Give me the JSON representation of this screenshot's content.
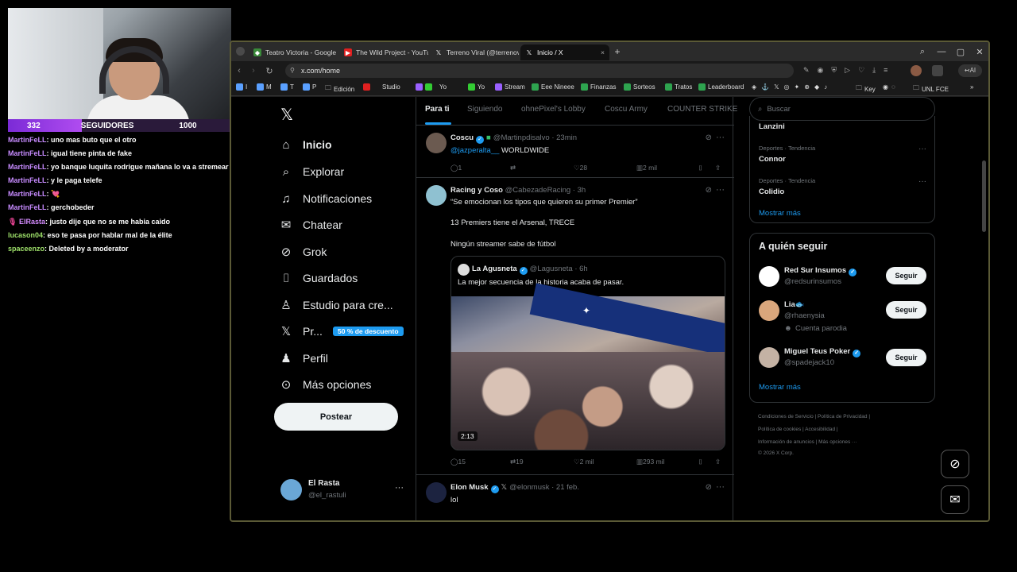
{
  "stream": {
    "followers_current": "332",
    "followers_label": "SEGUIDORES",
    "followers_goal": "1000",
    "followers_progress": 0.332
  },
  "chat": [
    {
      "user": "MartinFeLL",
      "msg": ": uno mas buto que el otro"
    },
    {
      "user": "MartinFeLL",
      "msg": ": igual tiene pinta de fake"
    },
    {
      "user": "MartinFeLL",
      "msg": ": yo banque luquita rodrigue mañana lo va a stremear"
    },
    {
      "user": "MartinFeLL",
      "msg": ": y le paga telefe"
    },
    {
      "user": "MartinFeLL",
      "msg": ": 💘"
    },
    {
      "user": "MartinFeLL",
      "msg": ": gerchobeder"
    },
    {
      "user": "ElRasta",
      "msg": ": justo dije que no se me habia caido"
    },
    {
      "user": "lucason04",
      "msg": ": eso te pasa por hablar mal de la élite"
    },
    {
      "user": "spaceenzo",
      "msg": ": Deleted by a moderator"
    }
  ],
  "browser": {
    "tabs": [
      "Teatro Victoria - Google",
      "The Wild Project - YouTu",
      "Terreno Viral (@terrenov",
      "Inicio / X"
    ],
    "new_tab": "+",
    "url": "x.com/home",
    "bookmarks": [
      "I",
      "M",
      "T",
      "P",
      "Edición",
      "Studio",
      "Yo",
      "Yo",
      "Stream",
      "Eee Nineee",
      "Finanzas",
      "Sorteos",
      "Tratos",
      "Leaderboard",
      "Key",
      "UNL FCE"
    ]
  },
  "nav": {
    "items": [
      "Inicio",
      "Explorar",
      "Notificaciones",
      "Chatear",
      "Grok",
      "Guardados",
      "Estudio para cre...",
      "Pr...",
      "Perfil",
      "Más opciones"
    ],
    "promo": "50 % de descuento",
    "post": "Postear",
    "account_name": "El Rasta",
    "account_handle": "@el_rastuli"
  },
  "feed": {
    "tabs": [
      "Para ti",
      "Siguiendo",
      "ohnePixel's Lobby",
      "Coscu Army",
      "COUNTER STRIKE"
    ],
    "tweets": [
      {
        "name": "Coscu",
        "handle": "@Martinpdisalvo · 23min",
        "text_link": "@jazperalta__",
        "text": " WORLDWIDE",
        "replies": "1",
        "retweets": "",
        "likes": "28",
        "views": "2 mil"
      },
      {
        "name": "Racing y Coso",
        "handle": "@CabezadeRacing · 3h",
        "lines": [
          "“Se emocionan los tipos que quieren su primer Premier”",
          "13 Premiers tiene el Arsenal, TRECE",
          "Ningún streamer sabe de fútbol"
        ],
        "quote_name": "La Agusneta",
        "quote_handle": "@Lagusneta · 6h",
        "quote_text": "La mejor secuencia de la historia acaba de pasar.",
        "duration": "2:13",
        "replies": "15",
        "retweets": "19",
        "likes": "2 mil",
        "views": "293 mil"
      },
      {
        "name": "Elon Musk",
        "handle": "@elonmusk · 21 feb.",
        "text": "lol"
      }
    ]
  },
  "sidebar": {
    "search_placeholder": "Buscar",
    "trends": [
      {
        "category": "",
        "name": "Lanzini"
      },
      {
        "category": "Deportes · Tendencia",
        "name": "Connor"
      },
      {
        "category": "Deportes · Tendencia",
        "name": "Colidio"
      }
    ],
    "show_more": "Mostrar más",
    "follow_title": "A quién seguir",
    "follow": [
      {
        "name": "Red Sur Insumos",
        "handle": "@redsurinsumos",
        "extra": "",
        "button": "Seguir"
      },
      {
        "name": "Lia🐟",
        "handle": "@rhaenysia",
        "extra": "Cuenta parodia",
        "button": "Seguir"
      },
      {
        "name": "Miguel Teus Poker",
        "handle": "@spadejack10",
        "extra": "",
        "button": "Seguir"
      }
    ],
    "footer": [
      "Condiciones de Servicio  |  Política de Privacidad  |",
      "Política de cookies  |  Accesibilidad  |",
      "Información de anuncios  |  Más opciones ···",
      "© 2026 X Corp."
    ]
  },
  "colors": {
    "accent": "#1d9bf0",
    "background": "#000000",
    "border": "#2f3336",
    "chat_user": "#c78bff"
  }
}
